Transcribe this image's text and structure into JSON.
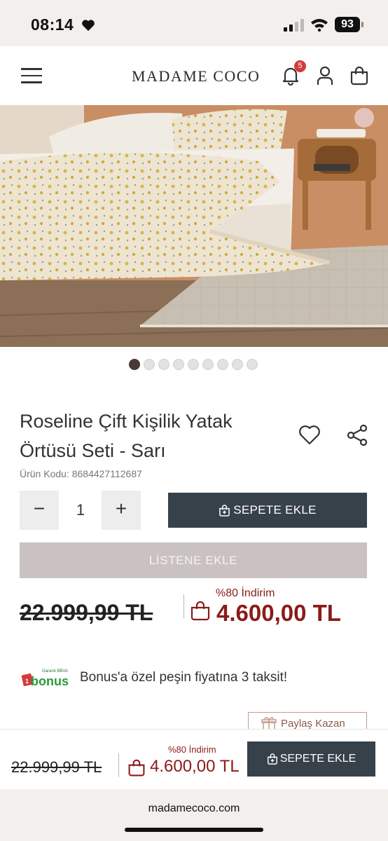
{
  "status_bar": {
    "time": "08:14",
    "battery": "93"
  },
  "header": {
    "brand": "MADAME COCO",
    "notification_count": "5"
  },
  "gallery": {
    "total_images": 9,
    "active_index": 0
  },
  "product": {
    "title": "Roseline Çift Kişilik Yatak Örtüsü Seti - Sarı",
    "code_label": "Ürün Kodu: 8684427112687",
    "quantity": "1",
    "minus": "−",
    "plus": "+",
    "add_to_cart": "SEPETE EKLE",
    "add_to_list": "LİSTENE EKLE",
    "old_price": "22.999,99 TL",
    "discount": "%80 İndirim",
    "new_price": "4.600,00 TL"
  },
  "bonus": {
    "logo_top": "Garanti BBVA",
    "logo_main": "bonus",
    "text": "Bonus'a özel peşin fiyatına 3 taksit!"
  },
  "share_earn": {
    "label": "Paylaş Kazan"
  },
  "sticky_bar": {
    "old_price": "22.999,99 TL",
    "discount": "%80 İndirim",
    "new_price": "4.600,00 TL",
    "add_to_cart": "SEPETE EKLE"
  },
  "browser": {
    "url": "madamecoco.com"
  },
  "colors": {
    "dark_button": "#37414a",
    "discount_red": "#8b1a1a",
    "list_button": "#c9c2c1",
    "chrome": "#f3efed"
  }
}
